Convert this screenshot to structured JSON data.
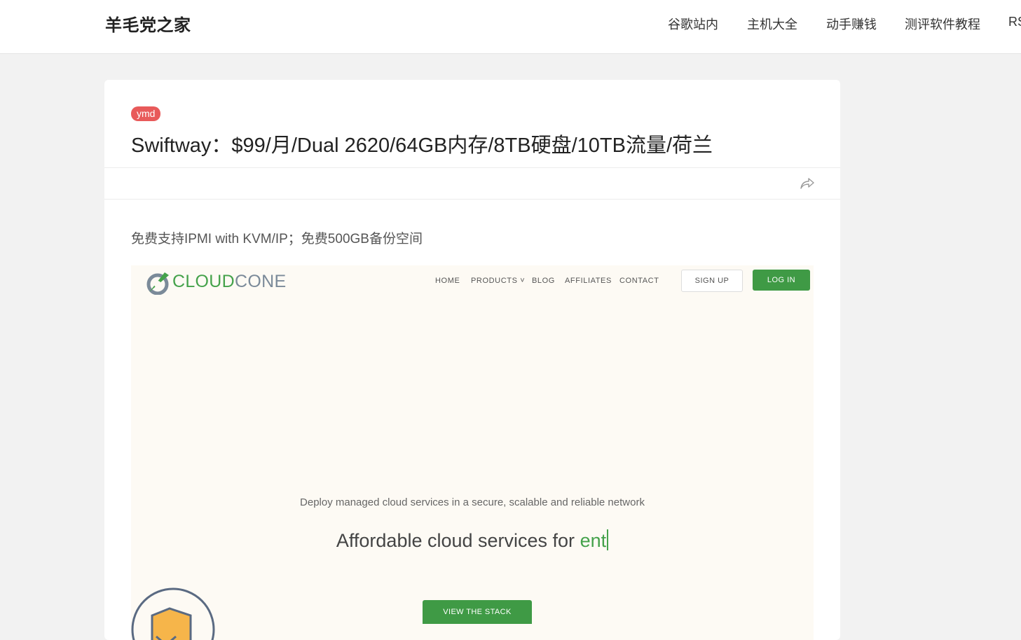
{
  "header": {
    "site_title": "羊毛党之家",
    "nav": [
      "谷歌站内",
      "主机大全",
      "动手赚钱",
      "测评软件教程",
      "RS"
    ]
  },
  "post": {
    "tag": "ymd",
    "title": "Swiftway：$99/月/Dual 2620/64GB内存/8TB硬盘/10TB流量/荷兰",
    "excerpt": "免费支持IPMI with KVM/IP；免费500GB备份空间",
    "share_icon": "share-icon"
  },
  "screenshot": {
    "logo_part1": "CLOUD",
    "logo_part2": "CONE",
    "nav": [
      "HOME",
      "PRODUCTS",
      "BLOG",
      "AFFILIATES",
      "CONTACT"
    ],
    "signup": "SIGN UP",
    "login": "LOG IN",
    "subheading": "Deploy managed cloud services in a secure, scalable and reliable network",
    "headline_main": "Affordable cloud services for ",
    "headline_typed": "ent",
    "cta": "VIEW THE STACK",
    "colors": {
      "green": "#45a24b",
      "tag_red": "#e85a5a"
    }
  }
}
